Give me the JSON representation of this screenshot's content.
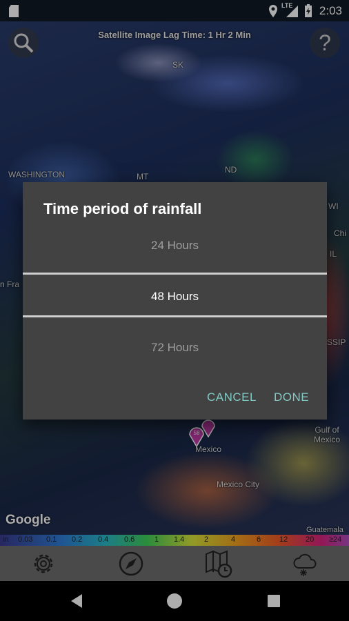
{
  "status_bar": {
    "time": "2:03",
    "network": "LTE"
  },
  "map": {
    "lag_text": "Satellite Image Lag Time: 1 Hr 2 Min",
    "labels": {
      "sk": "SK",
      "washington": "WASHINGTON",
      "nd": "ND",
      "mt": "MT",
      "wi": "WI",
      "chi": "Chi",
      "il": "IL",
      "san_fra": "n Fra",
      "ssip": "SSIP",
      "mexico_small": "Mexico",
      "mexico_city": "Mexico City",
      "gulf": "Gulf of\nMexico",
      "guatemala": "Guatemala"
    },
    "google": "Google"
  },
  "legend": {
    "labels": [
      "in",
      "0.03",
      "0.1",
      "0.2",
      "0.4",
      "0.6",
      "1",
      "1.4",
      "2",
      "4",
      "6",
      "12",
      "20",
      "≥24"
    ]
  },
  "dialog": {
    "title": "Time period of rainfall",
    "options": [
      "24 Hours",
      "48 Hours",
      "72 Hours"
    ],
    "selected_index": 1,
    "cancel_label": "CANCEL",
    "done_label": "DONE"
  },
  "icons": {
    "search": "search-icon",
    "help": "help-icon",
    "settings": "gear-icon",
    "locate": "compass-icon",
    "map_time": "map-clock-icon",
    "weather": "snow-cloud-icon"
  },
  "colors": {
    "accent": "#80cbc4",
    "dialog_bg": "#424242",
    "toolbar_bg": "#6e6e6e"
  }
}
